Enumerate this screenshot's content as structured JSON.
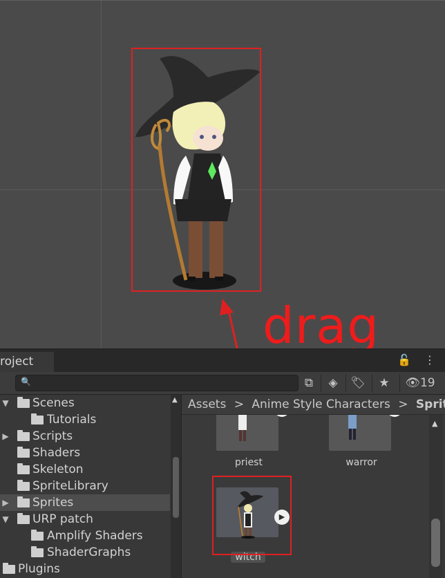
{
  "annotation": {
    "label": "drag",
    "color": "#e02020"
  },
  "project": {
    "tab_label": "roject",
    "toolbar": {
      "search_placeholder": "",
      "hidden_count": "19"
    },
    "tree": [
      {
        "label": "Scenes",
        "expanded": true,
        "level": 1
      },
      {
        "label": "Tutorials",
        "level": 2
      },
      {
        "label": "Scripts",
        "expandable": true,
        "level": 1
      },
      {
        "label": "Shaders",
        "level": 1
      },
      {
        "label": "Skeleton",
        "level": 1
      },
      {
        "label": "SpriteLibrary",
        "level": 1
      },
      {
        "label": "Sprites",
        "expandable": true,
        "selected": true,
        "level": 1
      },
      {
        "label": "URP patch",
        "expanded": true,
        "level": 1
      },
      {
        "label": "Amplify Shaders",
        "level": 2
      },
      {
        "label": "ShaderGraphs",
        "level": 2
      },
      {
        "label": "Plugins",
        "level": 0
      }
    ],
    "breadcrumb": [
      "Assets",
      ">",
      "Anime Style Characters",
      ">",
      "Sprite"
    ],
    "assets": [
      {
        "name": "priest"
      },
      {
        "name": "warror"
      },
      {
        "name": "witch"
      }
    ]
  }
}
